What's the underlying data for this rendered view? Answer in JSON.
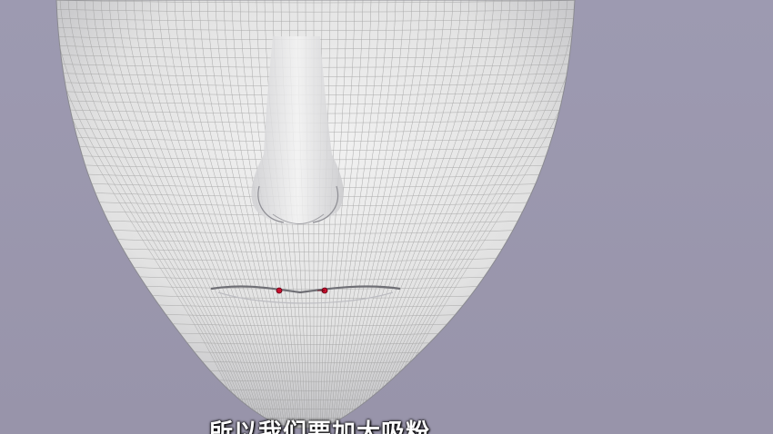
{
  "viewport": {
    "background_color": "#9a97ad",
    "object": "3d-face-mesh",
    "mesh_color": "#e4e4e4",
    "wire_color": "#8d8d8d",
    "marker_color": "#c8102e"
  },
  "subtitle": {
    "text": "所以我们要加大吸粉"
  }
}
